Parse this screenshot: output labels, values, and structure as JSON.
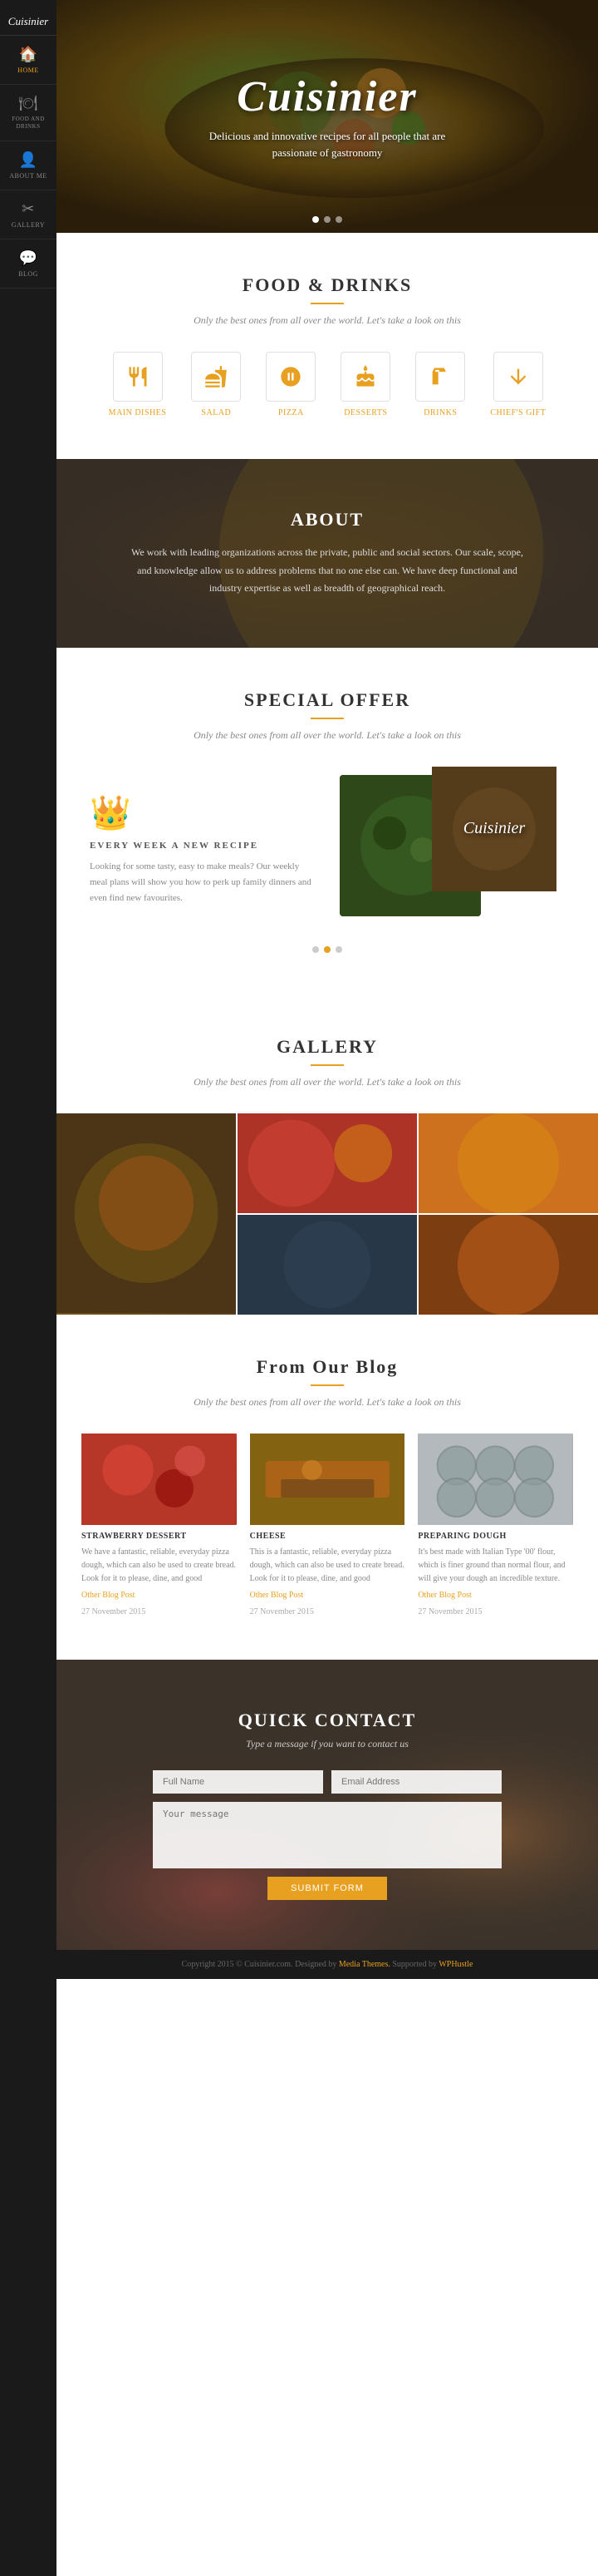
{
  "sidebar": {
    "logo": "Cuisinier",
    "items": [
      {
        "id": "home",
        "label": "HOME",
        "icon": "🏠",
        "active": true
      },
      {
        "id": "food-and-drinks",
        "label": "FOOD AND DRINKS",
        "icon": "🍽️",
        "active": false
      },
      {
        "id": "about-me",
        "label": "ABOUT ME",
        "icon": "👤",
        "active": false
      },
      {
        "id": "gallery",
        "label": "GALLERY",
        "icon": "✂️",
        "active": false
      },
      {
        "id": "blog",
        "label": "BLOG",
        "icon": "💬",
        "active": false
      }
    ]
  },
  "hero": {
    "title": "Cuisinier",
    "subtitle": "Delicious and innovative recipes for all people that are passionate of gastronomy",
    "dots": [
      1,
      2,
      3
    ]
  },
  "food_drinks": {
    "title": "FOOD & DRINKS",
    "subtitle": "Only the best ones from all over the world. Let's take a look on this",
    "categories": [
      {
        "id": "main-dishes",
        "label": "Main Dishes",
        "icon": "🍴"
      },
      {
        "id": "salad",
        "label": "Salad",
        "icon": "🥗"
      },
      {
        "id": "pizza",
        "label": "Pizza",
        "icon": "🍕"
      },
      {
        "id": "desserts",
        "label": "Desserts",
        "icon": "🎂"
      },
      {
        "id": "drinks",
        "label": "Drinks",
        "icon": "🍸"
      },
      {
        "id": "chiefs-gift",
        "label": "Chief's Gift",
        "icon": "⬇️"
      }
    ]
  },
  "about": {
    "title": "ABOUT",
    "text": "We work with leading organizations across the private, public and social sectors. Our scale, scope, and knowledge allow us to address problems that no one else can. We have deep functional and industry expertise as well as breadth of geographical reach."
  },
  "special_offer": {
    "title": "SPECIAL OFFER",
    "subtitle": "Only the best ones from all over the world. Let's take a look on this",
    "week_title": "EVERY WEEK A NEW RECIPE",
    "description": "Looking for some tasty, easy to make meals? Our weekly meal plans will show you how to perk up family dinners and even find new favourites.",
    "image_label": "Cuisinier",
    "dots": [
      1,
      2,
      3
    ]
  },
  "gallery": {
    "title": "GALLERY",
    "subtitle": "Only the best ones from all over the world. Let's take a look on this"
  },
  "blog": {
    "title": "From Our Blog",
    "subtitle": "Only the best ones from all over the world. Let's take a look on this",
    "posts": [
      {
        "id": "strawberry-dessert",
        "title": "STRAWBERRY DESSERT",
        "text": "We have a fantastic, reliable, everyday pizza dough, which can also be used to create bread. Look for it to please, dine, and good",
        "link": "Other Blog Post",
        "date": "27 November 2015"
      },
      {
        "id": "cheese",
        "title": "CHEESE",
        "text": "This is a fantastic, reliable, everyday pizza dough, which can also be used to create bread. Look for it to please, dine, and good",
        "link": "Other Blog Post",
        "date": "27 November 2015"
      },
      {
        "id": "preparing-dough",
        "title": "PREPARING DOUGH",
        "text": "It's best made with Italian Type '00' flour, which is finer ground than normal flour, and will give your dough an incredible texture.",
        "link": "Other Blog Post",
        "date": "27 November 2015"
      }
    ]
  },
  "contact": {
    "title": "QUICK CONTACT",
    "subtitle": "Type a message if you want to contact us",
    "fields": {
      "full_name_placeholder": "Full Name",
      "email_placeholder": "Email Address",
      "message_placeholder": "Your message",
      "submit_label": "SUBMIT FORM"
    }
  },
  "footer": {
    "text": "Copyright 2015 © Cuisinier.com. Designed by",
    "designer": "Media Themes",
    "supported_by": "Supported by",
    "supporter": "WPHustle"
  },
  "colors": {
    "accent": "#e8a020",
    "dark": "#1a1a1a",
    "sidebar_bg": "#1a1a1a",
    "text_dark": "#333333",
    "text_light": "#888888"
  }
}
